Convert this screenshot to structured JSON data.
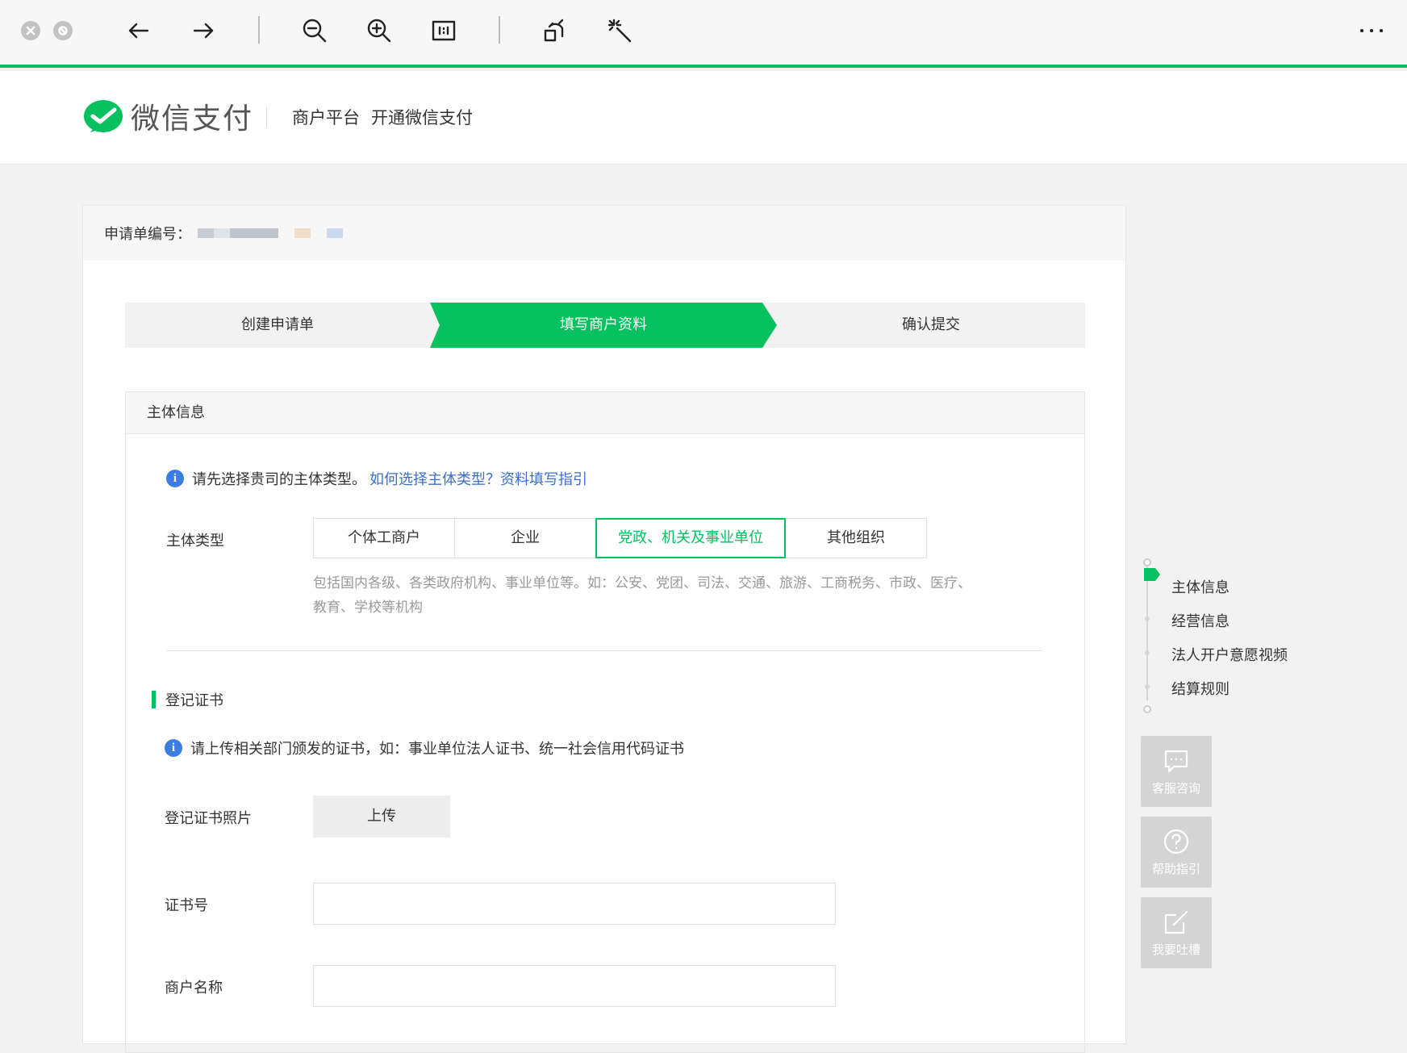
{
  "header": {
    "logo_text": "微信支付",
    "links": [
      "商户平台",
      "开通微信支付"
    ]
  },
  "application": {
    "number_label": "申请单编号："
  },
  "steps": [
    "创建申请单",
    "填写商户资料",
    "确认提交"
  ],
  "section": {
    "title": "主体信息",
    "info_text": "请先选择贵司的主体类型。",
    "info_link": "如何选择主体类型？资料填写指引",
    "entity_type_label": "主体类型",
    "entity_types": [
      "个体工商户",
      "企业",
      "党政、机关及事业单位",
      "其他组织"
    ],
    "selected_entity_type": "党政、机关及事业单位",
    "hint": "包括国内各级、各类政府机构、事业单位等。如：公安、党团、司法、交通、旅游、工商税务、市政、医疗、教育、学校等机构"
  },
  "certificate": {
    "title": "登记证书",
    "info_text": "请上传相关部门颁发的证书，如：事业单位法人证书、统一社会信用代码证书",
    "photo_label": "登记证书照片",
    "upload_label": "上传",
    "number_label": "证书号",
    "number_value": "",
    "merchant_name_label": "商户名称",
    "merchant_name_value": ""
  },
  "side_nav": [
    "主体信息",
    "经营信息",
    "法人开户意愿视频",
    "结算规则"
  ],
  "float_buttons": [
    "客服咨询",
    "帮助指引",
    "我要吐槽"
  ],
  "colors": {
    "brand_green": "#07c160",
    "link_blue": "#3b6fc9",
    "info_blue": "#3b7de0"
  }
}
